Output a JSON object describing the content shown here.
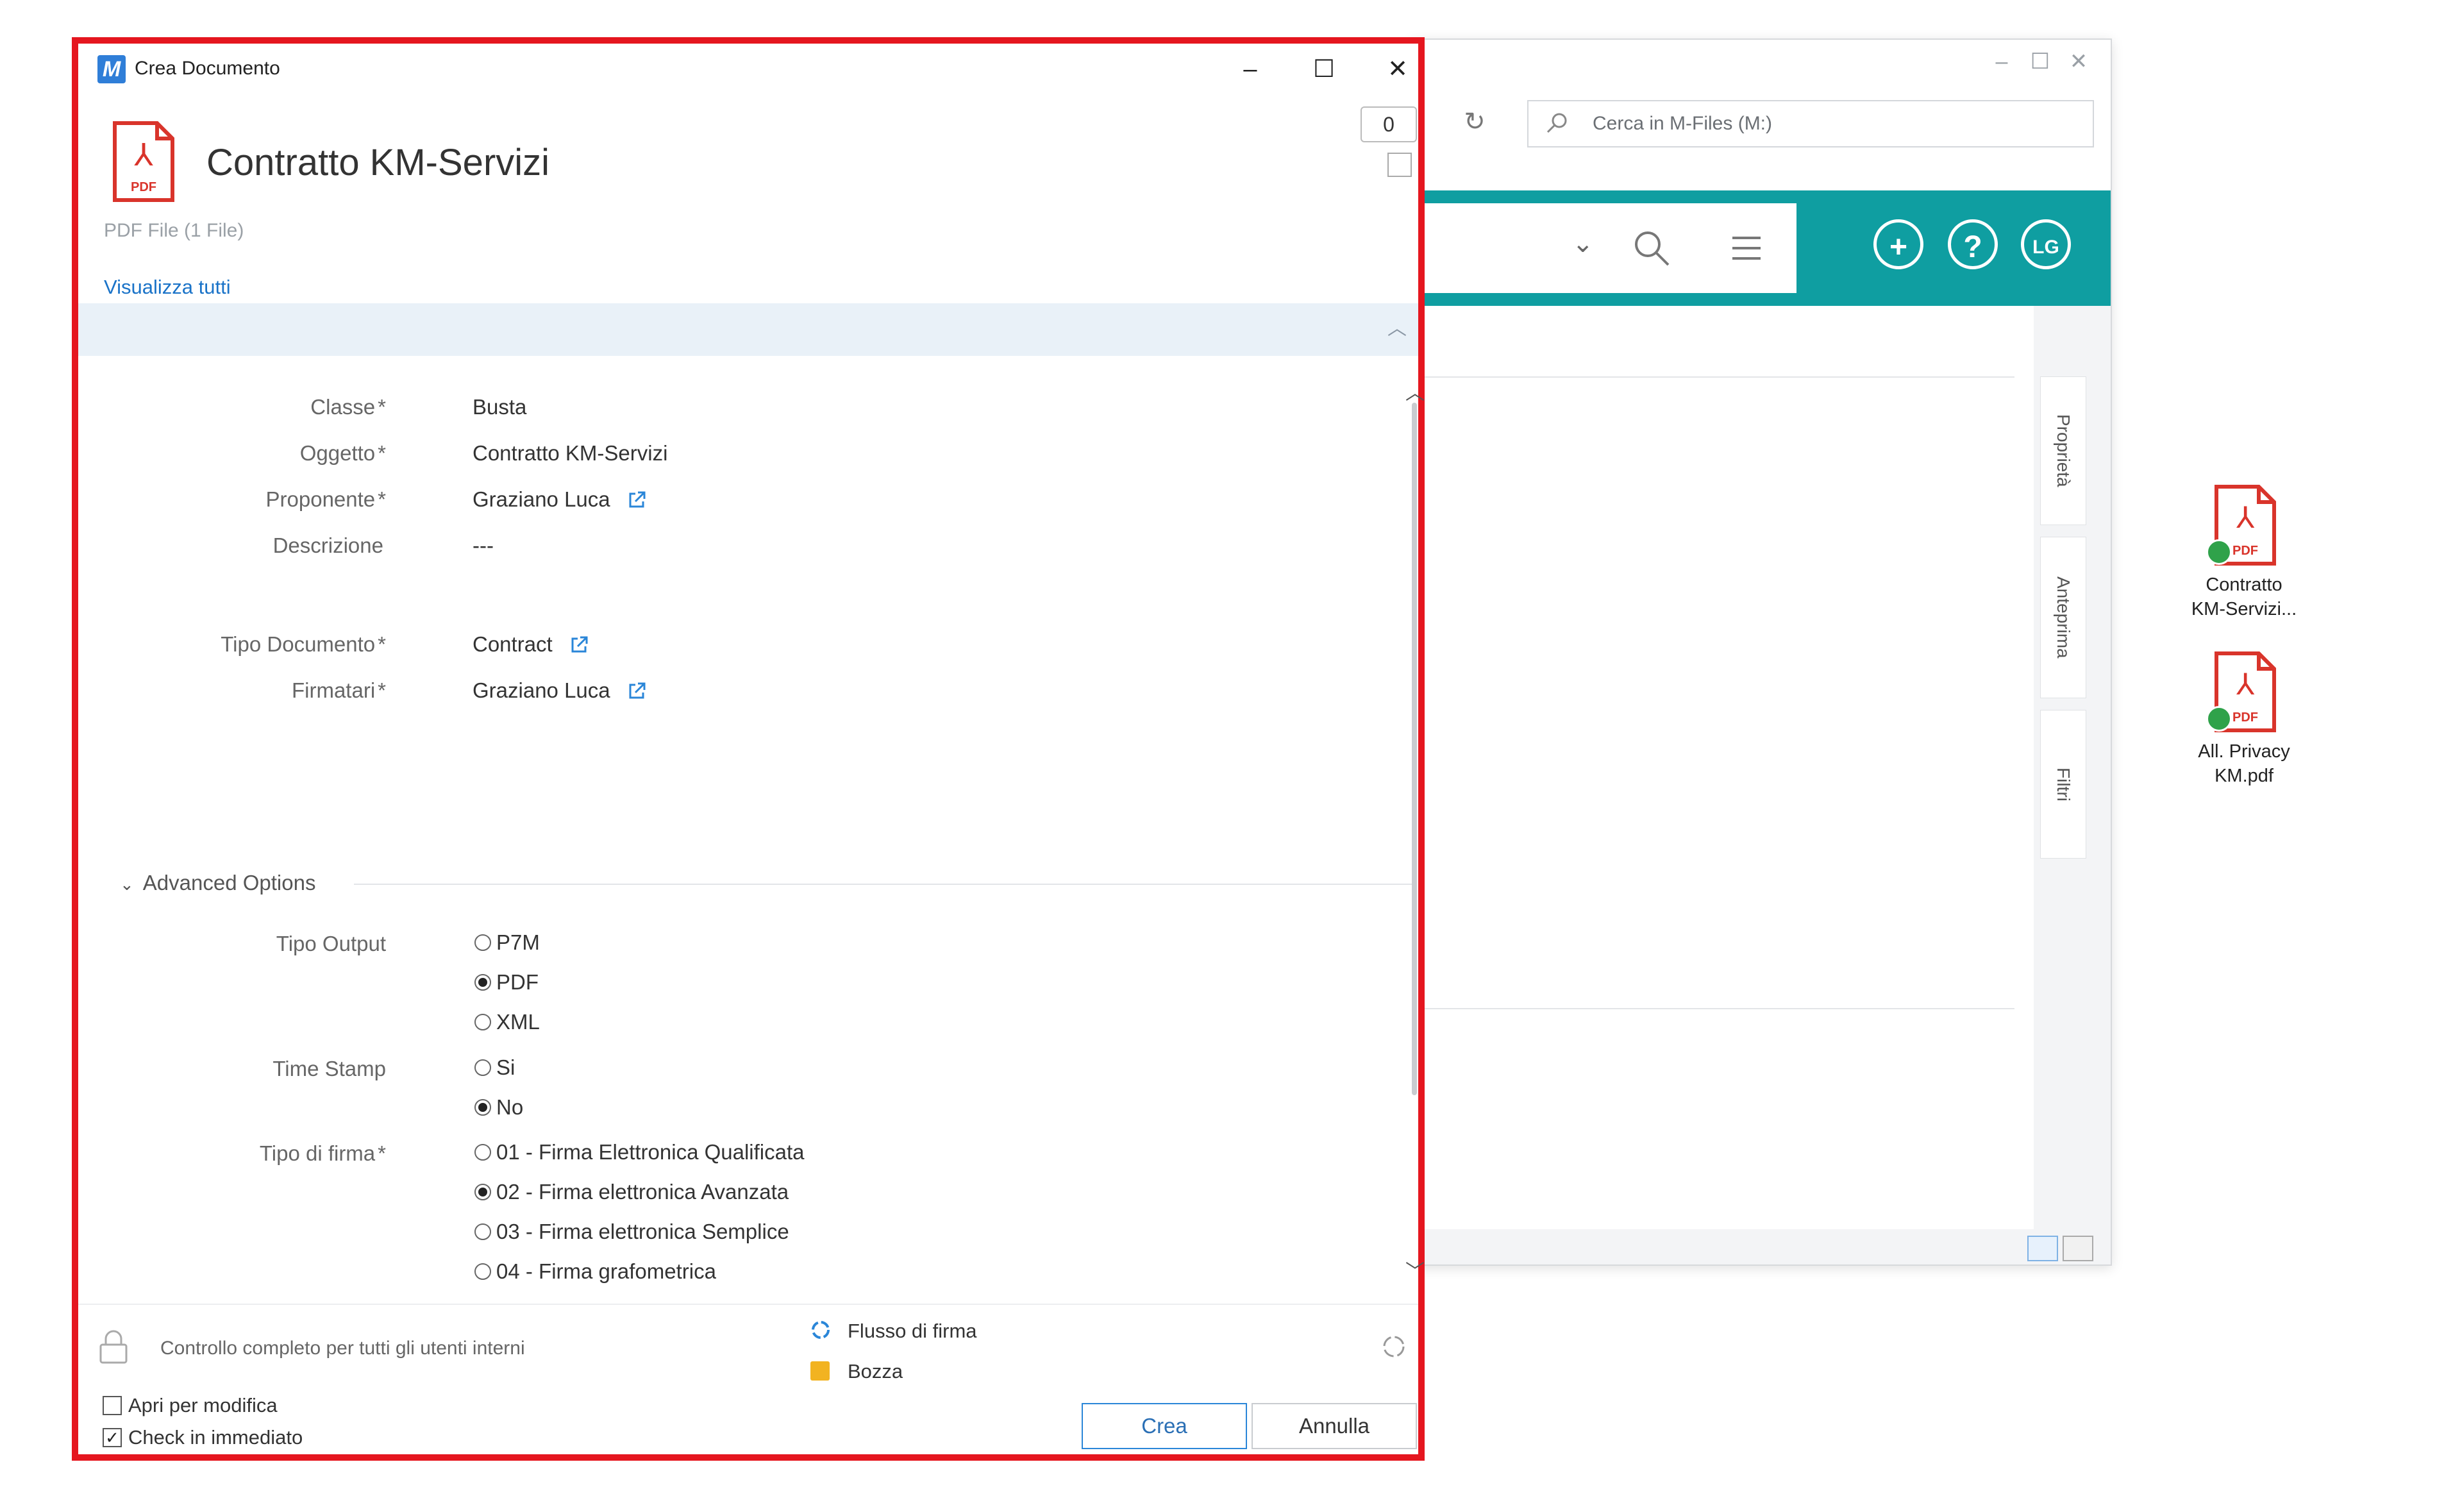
{
  "background_window": {
    "search_placeholder": "Cerca in M-Files (M:)",
    "user_initials": "LG",
    "side_tabs": [
      "Proprietà",
      "Anteprima",
      "Filtri"
    ],
    "accent_color": "#0f9ea1"
  },
  "desktop": {
    "items": [
      {
        "label_line1": "Contratto",
        "label_line2": "KM-Servizi...",
        "icon": "pdf-file-icon"
      },
      {
        "label_line1": "All. Privacy",
        "label_line2": "KM.pdf",
        "icon": "pdf-file-icon"
      }
    ]
  },
  "dialog": {
    "app_icon_letter": "M",
    "window_title": "Crea Documento",
    "doc_title": "Contratto KM-Servizi",
    "doc_subtitle": "PDF File (1 File)",
    "view_all": "Visualizza tutti",
    "comment_count": "0",
    "highlight_color": "#e5161f",
    "properties": [
      {
        "label": "Classe",
        "required": "*",
        "value": "Busta"
      },
      {
        "label": "Oggetto",
        "required": "*",
        "value": "Contratto KM-Servizi"
      },
      {
        "label": "Proponente",
        "required": "*",
        "value": "Graziano Luca"
      },
      {
        "label": "Descrizione",
        "required": "",
        "value": "---"
      },
      {
        "label": "Tipo Documento",
        "required": "*",
        "value": "Contract"
      },
      {
        "label": "Firmatari",
        "required": "*",
        "value": "Graziano Luca"
      }
    ],
    "advanced": {
      "heading": "Advanced Options",
      "tipo_output": {
        "label": "Tipo Output",
        "options": [
          "P7M",
          "PDF",
          "XML"
        ],
        "selected": "PDF"
      },
      "time_stamp": {
        "label": "Time Stamp",
        "options": [
          "Si",
          "No"
        ],
        "selected": "No"
      },
      "tipo_firma": {
        "label": "Tipo di firma",
        "required": "*",
        "options": [
          "01 - Firma Elettronica Qualificata",
          "02 - Firma elettronica Avanzata",
          "03 - Firma elettronica Semplice",
          "04 - Firma grafometrica"
        ],
        "selected": "02 - Firma elettronica Avanzata"
      }
    },
    "footer": {
      "permissions": "Controllo completo per tutti gli utenti interni",
      "workflow": "Flusso di firma",
      "state": "Bozza",
      "open_for_edit": {
        "label": "Apri per modifica",
        "checked": false
      },
      "check_in": {
        "label": "Check in immediato",
        "checked": true
      },
      "create_button": "Crea",
      "cancel_button": "Annulla"
    }
  }
}
